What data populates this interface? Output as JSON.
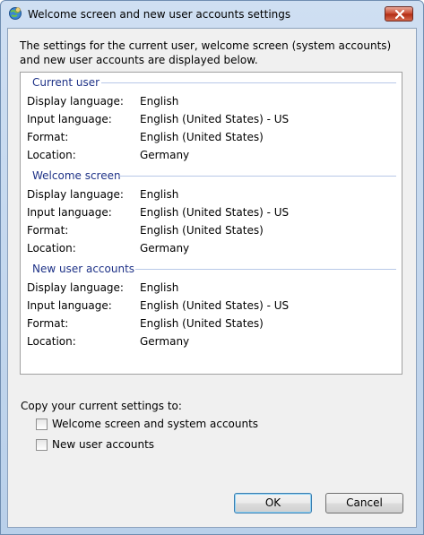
{
  "window": {
    "title": "Welcome screen and new user accounts settings"
  },
  "description": "The settings for the current user, welcome screen (system accounts) and new user accounts are displayed below.",
  "sections": [
    {
      "title": "Current user",
      "rows": [
        {
          "label": "Display language:",
          "value": "English"
        },
        {
          "label": "Input language:",
          "value": "English (United States) - US"
        },
        {
          "label": "Format:",
          "value": "English (United States)"
        },
        {
          "label": "Location:",
          "value": "Germany"
        }
      ]
    },
    {
      "title": "Welcome screen",
      "rows": [
        {
          "label": "Display language:",
          "value": "English"
        },
        {
          "label": "Input language:",
          "value": "English (United States) - US"
        },
        {
          "label": "Format:",
          "value": "English (United States)"
        },
        {
          "label": "Location:",
          "value": "Germany"
        }
      ]
    },
    {
      "title": "New user accounts",
      "rows": [
        {
          "label": "Display language:",
          "value": "English"
        },
        {
          "label": "Input language:",
          "value": "English (United States) - US"
        },
        {
          "label": "Format:",
          "value": "English (United States)"
        },
        {
          "label": "Location:",
          "value": "Germany"
        }
      ]
    }
  ],
  "copy": {
    "label": "Copy your current settings to:",
    "options": [
      {
        "label": "Welcome screen and system accounts",
        "checked": false
      },
      {
        "label": "New user accounts",
        "checked": false
      }
    ]
  },
  "buttons": {
    "ok": "OK",
    "cancel": "Cancel"
  },
  "colors": {
    "section_heading": "#1e3287",
    "close_button": "#c7462c"
  },
  "icons": {
    "app": "globe-icon",
    "close": "close-icon"
  }
}
